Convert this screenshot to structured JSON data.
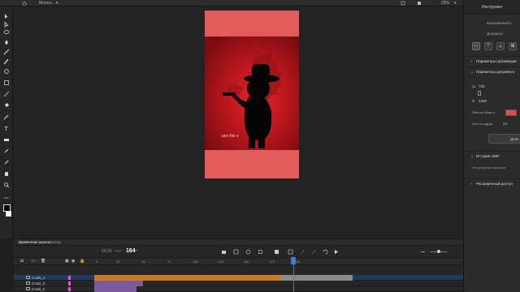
{
  "app": {
    "document_tab": "Монта...",
    "workspace_label": "Инструмен",
    "zoom_value": "23%"
  },
  "properties": {
    "object_label": "Безымянный-1",
    "document_label": "Документ",
    "sections": {
      "publish": "Параметры публикации",
      "document": "Параметры документа",
      "swf_history": "История SWF",
      "advanced": "Расширенный доступ"
    },
    "width_label": "Ш",
    "width_value": "720",
    "height_label": "В",
    "height_value": "1280",
    "workarea_label": "Рабочая область",
    "stage_color": "#e44b4b",
    "fps_label": "Частота кадров",
    "fps_value": "24",
    "more_button": "Допо",
    "swf_empty": "Нет доступных журналов"
  },
  "stage": {
    "overlay_text": "are the v",
    "pasteboard_color": "#e35c5c"
  },
  "timeline": {
    "tabs": [
      "Временная шкала",
      "Вывод"
    ],
    "fps_display": "24,00",
    "fps_unit": "кадр/с",
    "current_frame": "164",
    "ruler_ticks": [
      "5",
      "10",
      "15",
      "20",
      "25",
      "30",
      "35",
      "40",
      "45",
      "50",
      "55",
      "60",
      "65",
      "70",
      "75",
      "80",
      "85",
      "90",
      "95",
      "100",
      "105",
      "110",
      "115",
      "120",
      "125",
      "130",
      "135",
      "140",
      "145",
      "150",
      "155",
      "160",
      "165",
      "170",
      "175",
      "180",
      "185",
      "190",
      "195",
      "200",
      "205",
      "210"
    ],
    "layers": [
      {
        "name": "Слой_4",
        "color": "#d85bd8",
        "selected": true
      },
      {
        "name": "Слой_3",
        "color": "#d85bd8",
        "selected": false
      },
      {
        "name": "Слой_2",
        "color": "#d85bd8",
        "selected": false
      }
    ]
  },
  "icons": {
    "tools": [
      "selection-icon",
      "subselection-icon",
      "lasso-icon",
      "pen-icon",
      "text-icon",
      "line-icon",
      "rectangle-icon",
      "oval-icon",
      "pencil-icon",
      "brush-icon",
      "paint-bucket-icon",
      "eyedropper-icon",
      "eraser-icon",
      "hand-icon",
      "zoom-icon"
    ]
  }
}
